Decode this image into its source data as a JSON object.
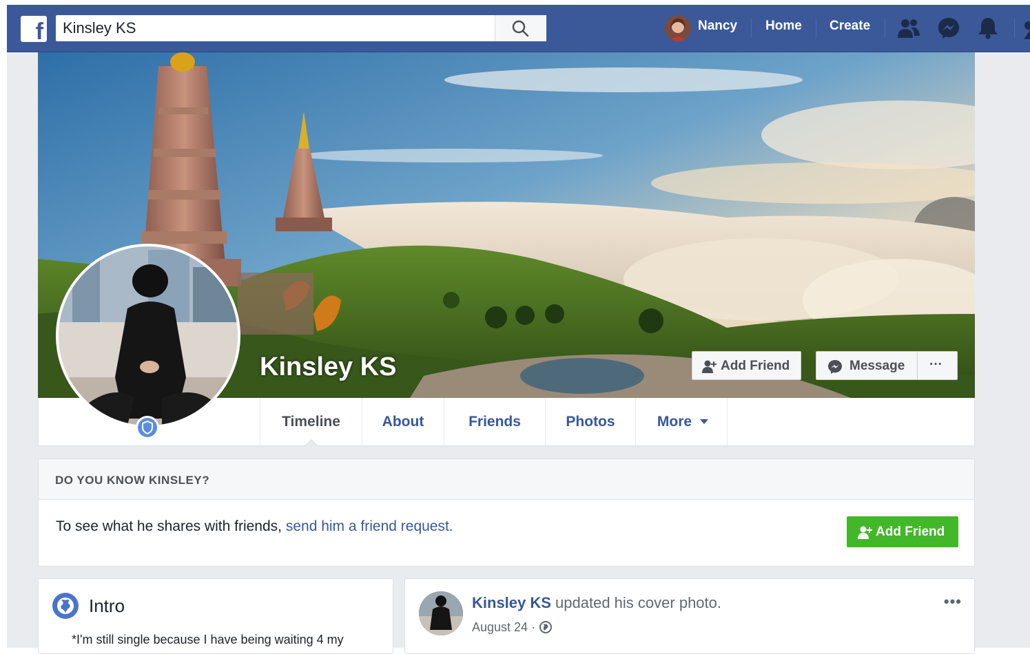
{
  "topbar": {
    "search_value": "Kinsley KS",
    "user_name": "Nancy",
    "home_label": "Home",
    "create_label": "Create",
    "brand_color": "#3b5998",
    "logo_letter": "f"
  },
  "profile": {
    "name": "Kinsley KS",
    "add_friend_label": "Add Friend",
    "message_label": "Message",
    "more_dots": "···"
  },
  "tabs": [
    {
      "label": "Timeline"
    },
    {
      "label": "About"
    },
    {
      "label": "Friends"
    },
    {
      "label": "Photos"
    },
    {
      "label": "More"
    }
  ],
  "know_card": {
    "title": "DO YOU KNOW KINSLEY?",
    "text": "To see what he shares with friends, ",
    "link": "send him a friend request.",
    "button_label": "Add Friend",
    "button_color": "#42b72a"
  },
  "intro": {
    "title": "Intro",
    "bio": "*I'm still single because I have being waiting 4 my"
  },
  "post": {
    "author": "Kinsley KS",
    "action": " updated his cover photo.",
    "date": "August 24",
    "separator": " · ",
    "menu": "•••"
  }
}
